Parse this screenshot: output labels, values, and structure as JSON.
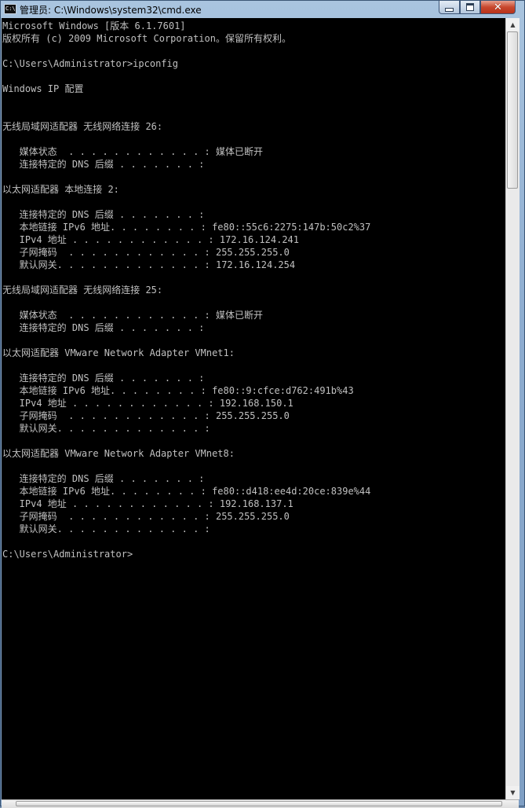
{
  "window": {
    "title": "管理员: C:\\Windows\\system32\\cmd.exe",
    "app_icon_text": "C:\\",
    "icons": {
      "app": "cmd-icon",
      "minimize": "minimize-icon",
      "maximize": "maximize-icon",
      "close": "close-icon"
    }
  },
  "console": {
    "lines": [
      "Microsoft Windows [版本 6.1.7601]",
      "版权所有 (c) 2009 Microsoft Corporation。保留所有权利。",
      "",
      "C:\\Users\\Administrator>ipconfig",
      "",
      "Windows IP 配置",
      "",
      "",
      "无线局域网适配器 无线网络连接 26:",
      "",
      "   媒体状态  . . . . . . . . . . . . : 媒体已断开",
      "   连接特定的 DNS 后缀 . . . . . . . :",
      "",
      "以太网适配器 本地连接 2:",
      "",
      "   连接特定的 DNS 后缀 . . . . . . . :",
      "   本地链接 IPv6 地址. . . . . . . . : fe80::55c6:2275:147b:50c2%37",
      "   IPv4 地址 . . . . . . . . . . . . : 172.16.124.241",
      "   子网掩码  . . . . . . . . . . . . : 255.255.255.0",
      "   默认网关. . . . . . . . . . . . . : 172.16.124.254",
      "",
      "无线局域网适配器 无线网络连接 25:",
      "",
      "   媒体状态  . . . . . . . . . . . . : 媒体已断开",
      "   连接特定的 DNS 后缀 . . . . . . . :",
      "",
      "以太网适配器 VMware Network Adapter VMnet1:",
      "",
      "   连接特定的 DNS 后缀 . . . . . . . :",
      "   本地链接 IPv6 地址. . . . . . . . : fe80::9:cfce:d762:491b%43",
      "   IPv4 地址 . . . . . . . . . . . . : 192.168.150.1",
      "   子网掩码  . . . . . . . . . . . . : 255.255.255.0",
      "   默认网关. . . . . . . . . . . . . :",
      "",
      "以太网适配器 VMware Network Adapter VMnet8:",
      "",
      "   连接特定的 DNS 后缀 . . . . . . . :",
      "   本地链接 IPv6 地址. . . . . . . . : fe80::d418:ee4d:20ce:839e%44",
      "   IPv4 地址 . . . . . . . . . . . . : 192.168.137.1",
      "   子网掩码  . . . . . . . . . . . . : 255.255.255.0",
      "   默认网关. . . . . . . . . . . . . :",
      "",
      "C:\\Users\\Administrator>"
    ]
  }
}
